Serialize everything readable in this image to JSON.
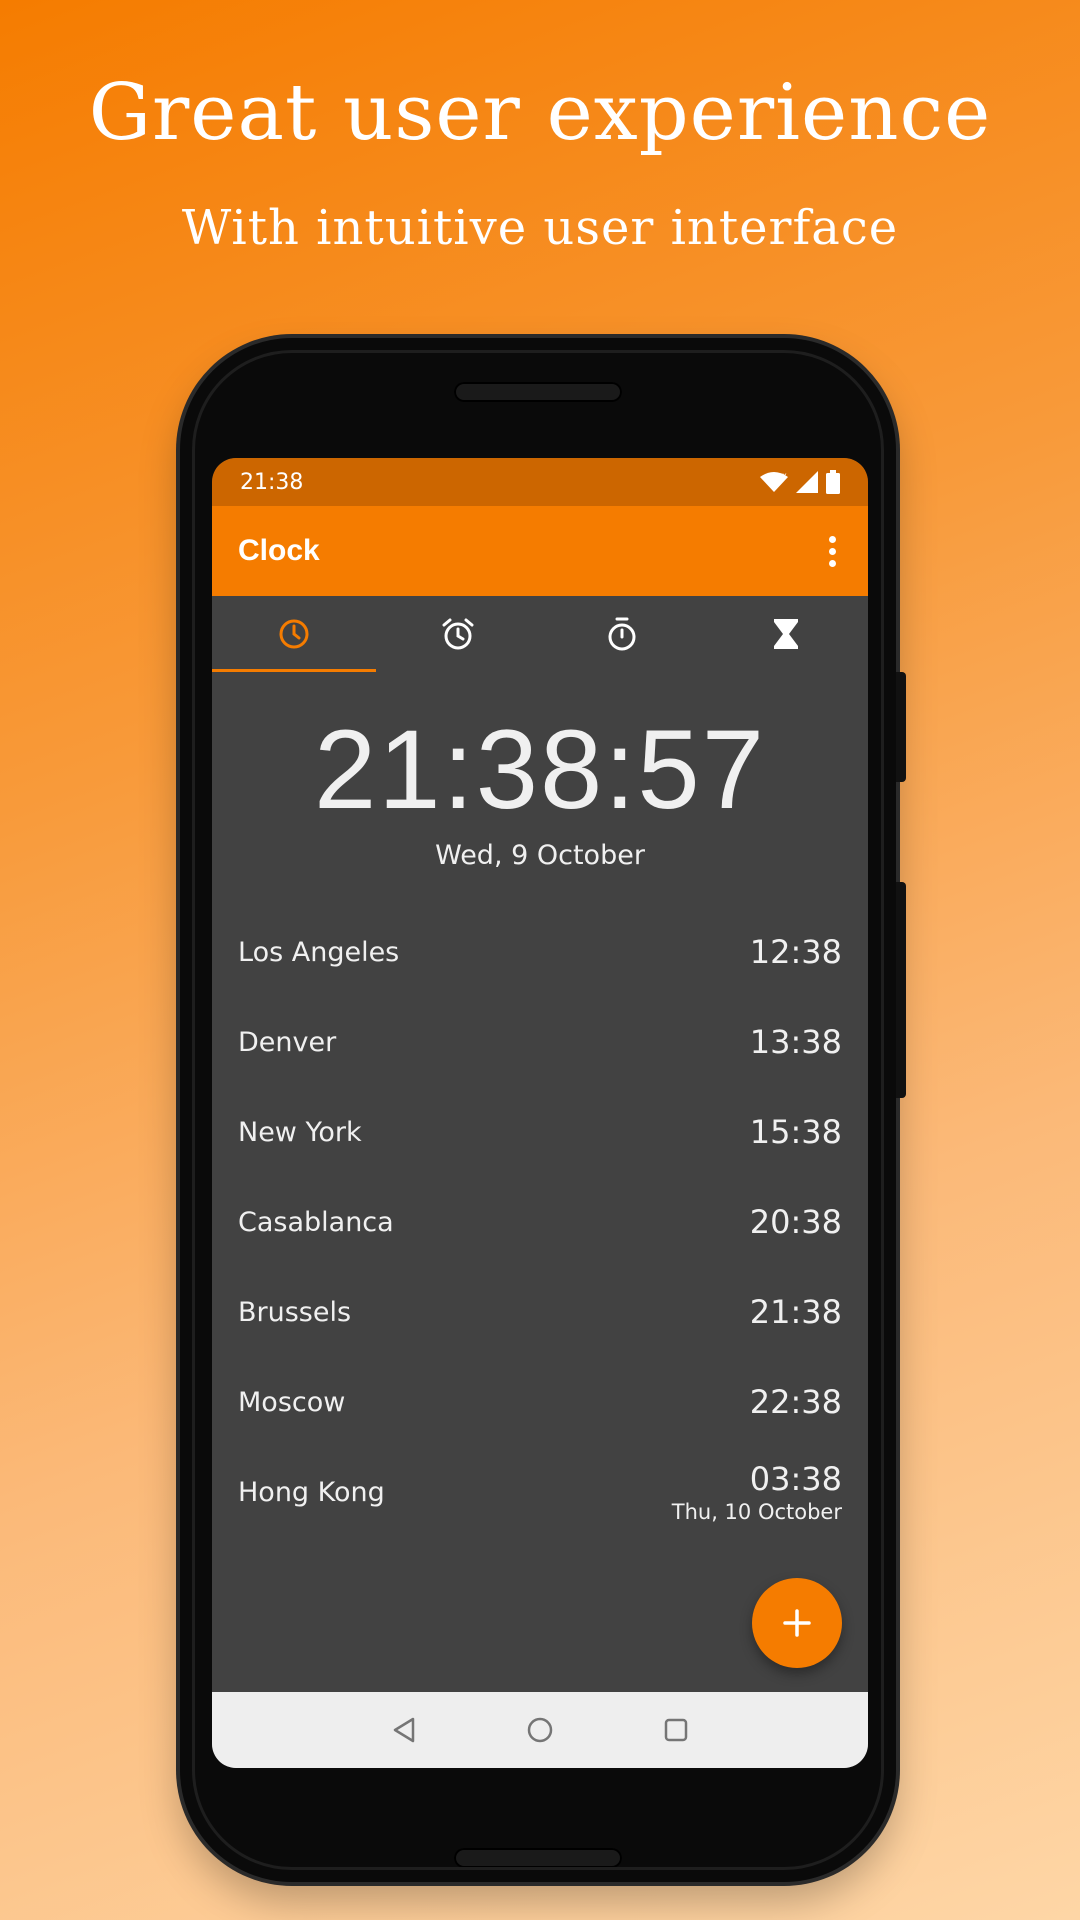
{
  "headline": {
    "title": "Great user experience",
    "subtitle": "With intuitive user interface"
  },
  "status_bar": {
    "time": "21:38",
    "icons": [
      "wifi-icon",
      "signal-icon",
      "battery-icon"
    ]
  },
  "app_bar": {
    "title": "Clock",
    "menu_icon": "more-vert-icon"
  },
  "tabs": [
    {
      "name": "clock",
      "icon": "clock-icon",
      "active": true
    },
    {
      "name": "alarm",
      "icon": "alarm-icon",
      "active": false
    },
    {
      "name": "stopwatch",
      "icon": "stopwatch-icon",
      "active": false
    },
    {
      "name": "timer",
      "icon": "hourglass-icon",
      "active": false
    }
  ],
  "main_clock": {
    "time": "21:38:57",
    "date": "Wed, 9 October"
  },
  "cities": [
    {
      "name": "Los Angeles",
      "time": "12:38",
      "sub": ""
    },
    {
      "name": "Denver",
      "time": "13:38",
      "sub": ""
    },
    {
      "name": "New York",
      "time": "15:38",
      "sub": ""
    },
    {
      "name": "Casablanca",
      "time": "20:38",
      "sub": ""
    },
    {
      "name": "Brussels",
      "time": "21:38",
      "sub": ""
    },
    {
      "name": "Moscow",
      "time": "22:38",
      "sub": ""
    },
    {
      "name": "Hong Kong",
      "time": "03:38",
      "sub": "Thu, 10 October"
    }
  ],
  "fab": {
    "icon": "plus-icon"
  },
  "nav": [
    "back-icon",
    "home-icon",
    "recents-icon"
  ],
  "colors": {
    "accent": "#f57c00",
    "status_bar": "#cc6600",
    "screen_bg": "#424242",
    "text": "#f0f0f0"
  }
}
